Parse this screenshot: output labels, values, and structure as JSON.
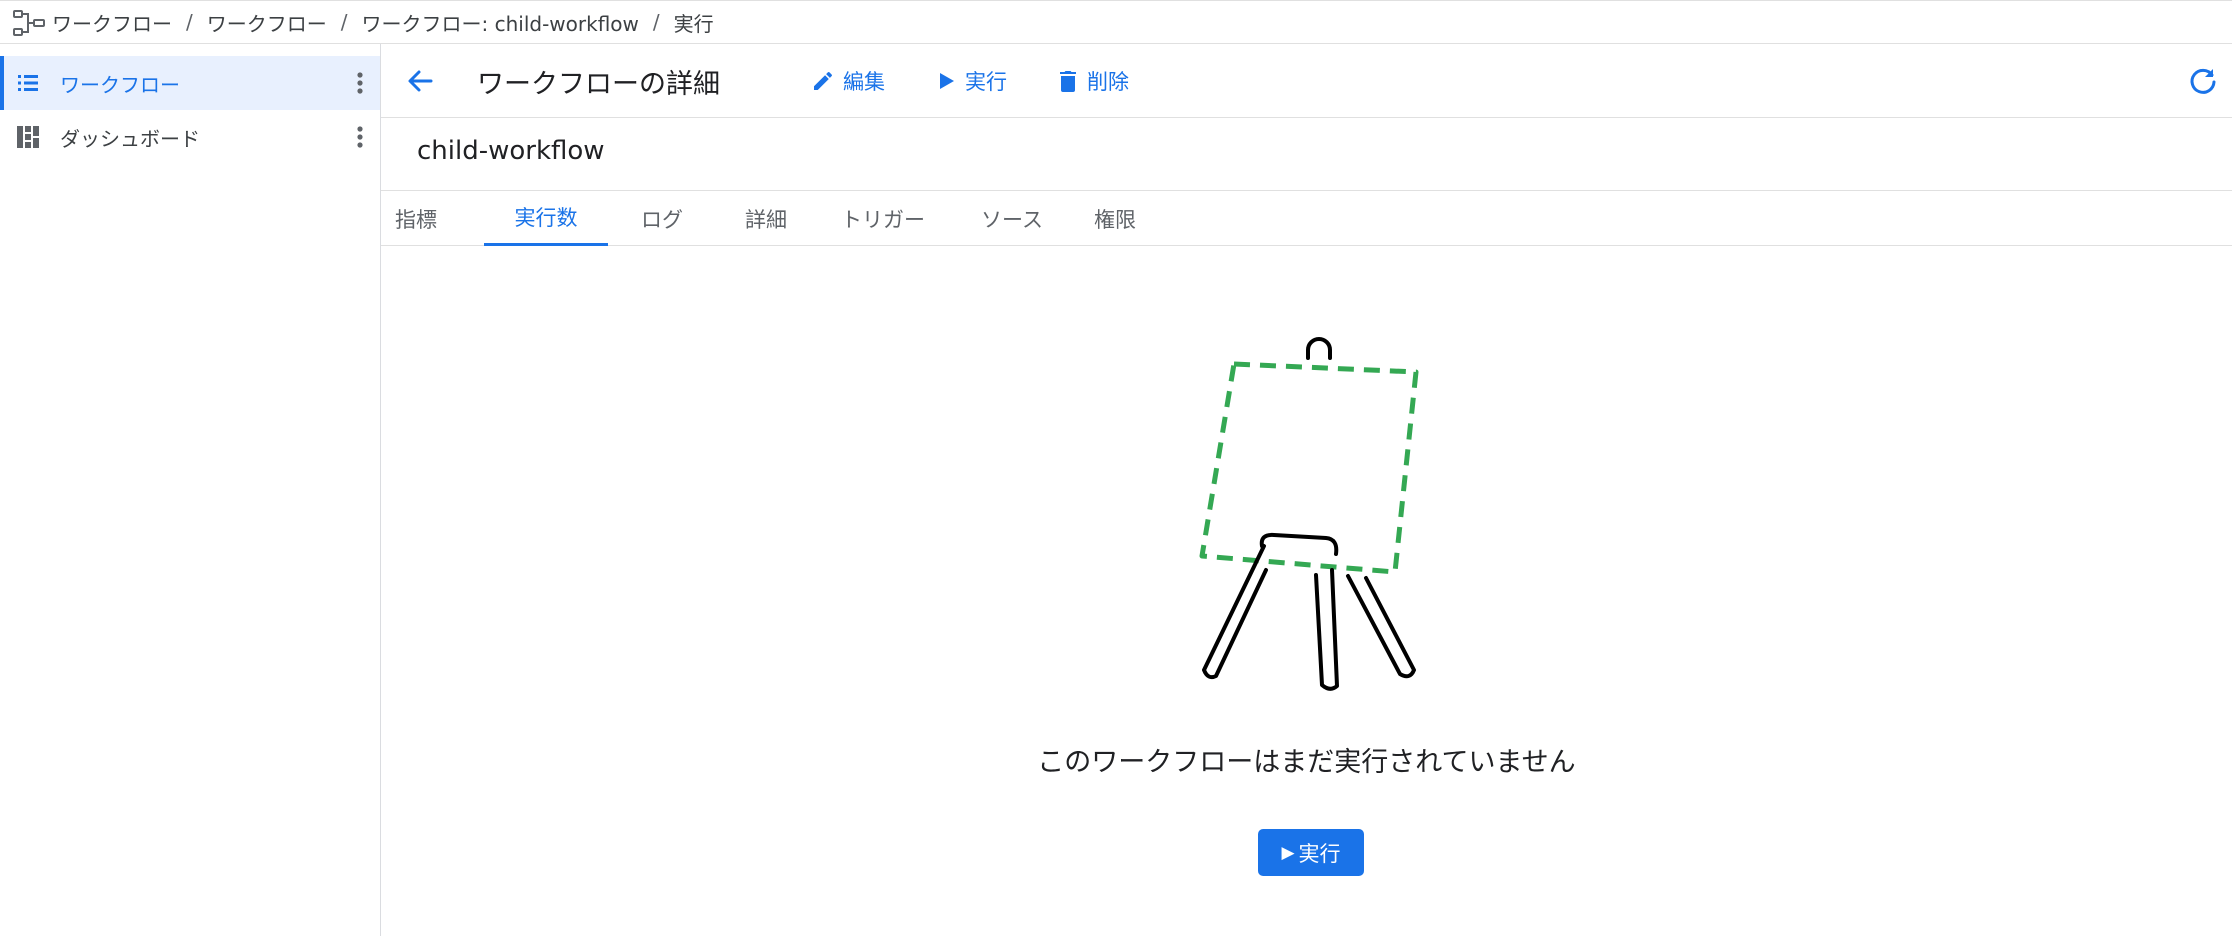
{
  "breadcrumb": {
    "items": [
      "ワークフロー",
      "ワークフロー",
      "ワークフロー: child-workflow",
      "実行"
    ],
    "separator": "/"
  },
  "sidebar": {
    "items": [
      {
        "label": "ワークフロー",
        "icon": "list-icon",
        "active": true
      },
      {
        "label": "ダッシュボード",
        "icon": "dashboard-icon",
        "active": false
      }
    ]
  },
  "header": {
    "title": "ワークフローの詳細",
    "actions": [
      {
        "label": "編集",
        "icon": "edit-icon"
      },
      {
        "label": "実行",
        "icon": "play-icon"
      },
      {
        "label": "削除",
        "icon": "delete-icon"
      }
    ]
  },
  "workflow": {
    "name": "child-workflow"
  },
  "tabs": [
    {
      "label": "指標"
    },
    {
      "label": "実行数",
      "active": true
    },
    {
      "label": "ログ"
    },
    {
      "label": "詳細"
    },
    {
      "label": "トリガー"
    },
    {
      "label": "ソース"
    },
    {
      "label": "権限"
    }
  ],
  "empty_state": {
    "message": "このワークフローはまだ実行されていません",
    "button_label": "実行",
    "button_icon": "▶",
    "illustration": "easel-icon"
  },
  "colors": {
    "accent": "#1a73e8",
    "active_bg": "#e8f0fe",
    "dashed_green": "#34a853"
  }
}
